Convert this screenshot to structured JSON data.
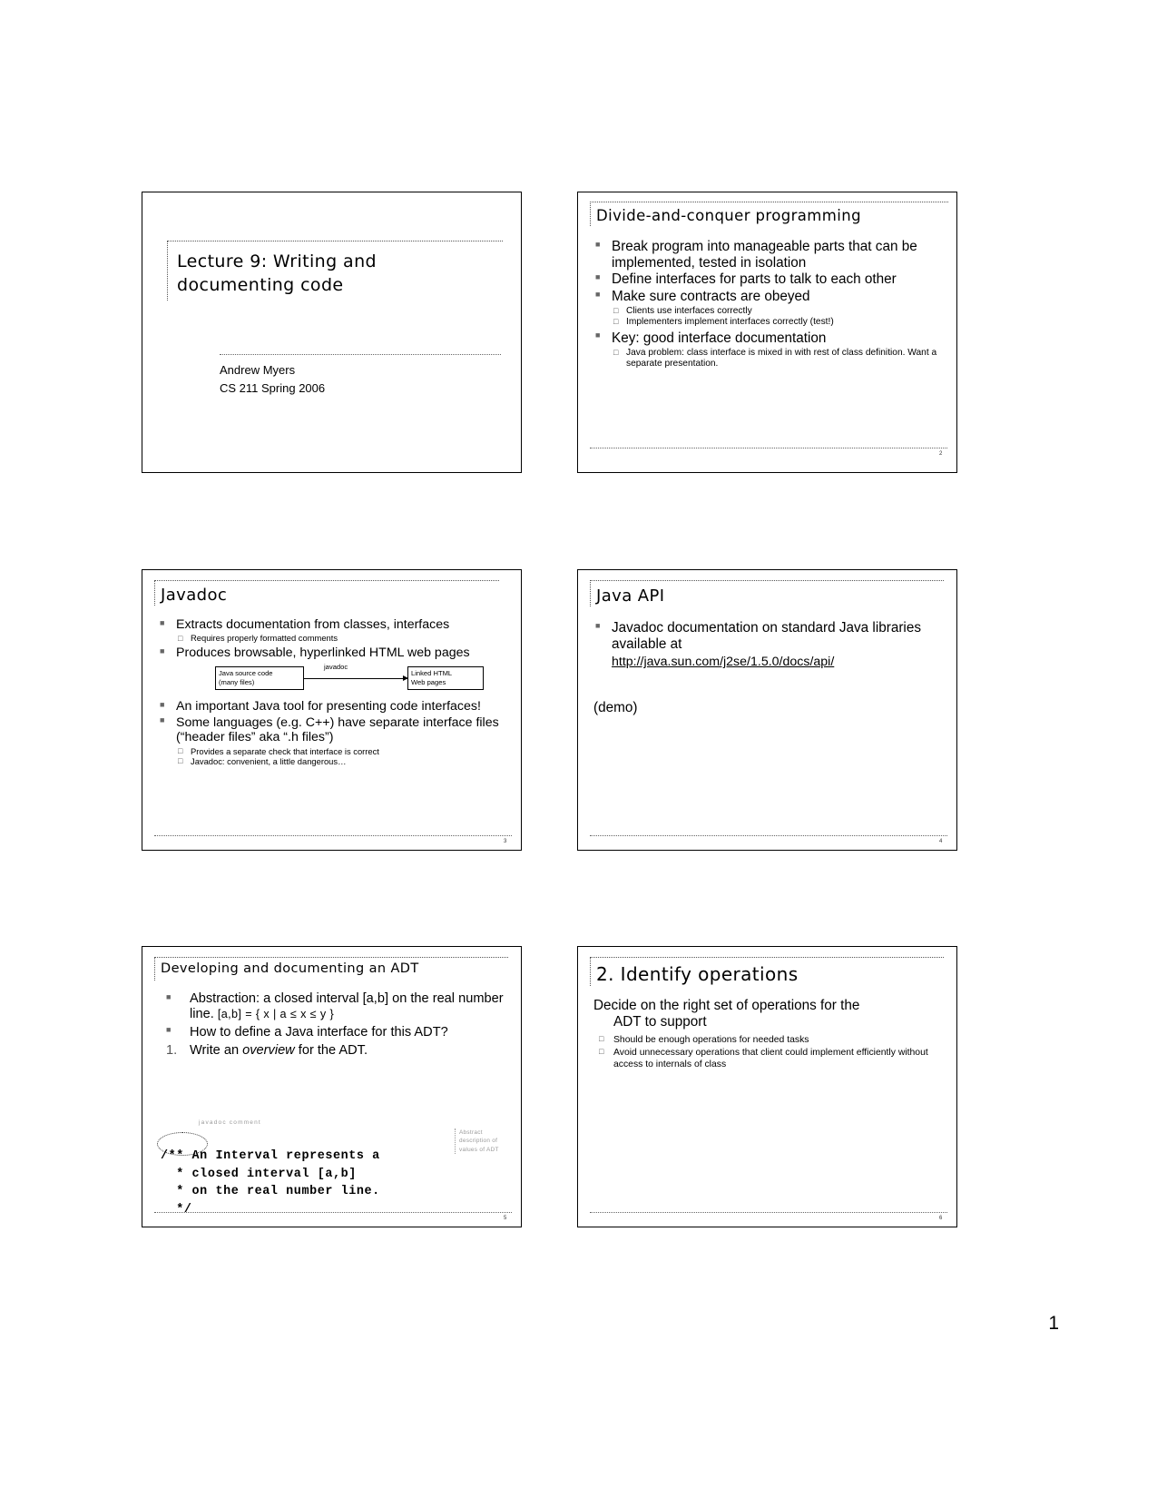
{
  "document": {
    "page_number": "1"
  },
  "slides": [
    {
      "number": "",
      "title_line1": "Lecture 9: Writing and",
      "title_line2": "documenting code",
      "author": "Andrew Myers",
      "course": "CS 211 Spring 2006"
    },
    {
      "number": "2",
      "title": "Divide-and-conquer programming",
      "bullets": [
        {
          "text": "Break program into manageable parts that can be implemented, tested in isolation",
          "sub": []
        },
        {
          "text": "Define interfaces for parts to talk to each other",
          "sub": []
        },
        {
          "text": "Make sure contracts are obeyed",
          "sub": [
            "Clients use interfaces correctly",
            "Implementers implement interfaces correctly (test!)"
          ]
        },
        {
          "text": "Key: good interface documentation",
          "sub": [
            "Java problem: class interface is mixed in with rest of class definition. Want a separate presentation."
          ]
        }
      ]
    },
    {
      "number": "3",
      "title": "Javadoc",
      "bullets": [
        {
          "text": "Extracts documentation from classes, interfaces",
          "sub": [
            "Requires properly formatted comments"
          ]
        },
        {
          "text": "Produces browsable, hyperlinked HTML web pages",
          "sub": []
        },
        {
          "text": "An important Java tool for presenting code interfaces!",
          "sub": []
        },
        {
          "text": "Some languages (e.g. C++) have separate interface files (“header files” aka “.h files”)",
          "sub": [
            "Provides a separate check that interface is correct",
            "Javadoc: convenient, a little dangerous…"
          ]
        }
      ],
      "diagram": {
        "source_line1": "Java source code",
        "source_line2": "(many files)",
        "arrow_label": "javadoc",
        "target_line1": "Linked HTML",
        "target_line2": "Web pages"
      }
    },
    {
      "number": "4",
      "title": "Java API",
      "bullets": [
        {
          "text": "Javadoc documentation on standard Java libraries available at",
          "sub": []
        }
      ],
      "url": "http://java.sun.com/j2se/1.5.0/docs/api/",
      "demo": "(demo)"
    },
    {
      "number": "5",
      "title": "Developing and documenting an ADT",
      "bullets": [
        {
          "text_a": "Abstraction: a closed interval [a,b] on the real number line. ",
          "text_b": "[a,b] = { x | a ≤ x ≤ y }"
        },
        {
          "text_a": "How to define a Java interface for this ADT?",
          "text_b": ""
        }
      ],
      "numbered": {
        "marker": "1.",
        "text_pre": "Write an ",
        "text_em": "overview",
        "text_post": " for the ADT."
      },
      "code": "/** An Interval represents a\n  * closed interval [a,b]\n  * on the real number line.\n  */",
      "annotation_top": "javadoc comment",
      "annotation_right": "Abstract description of values of ADT"
    },
    {
      "number": "6",
      "title": "2. Identify operations",
      "lead_line1": "Decide on the right set of operations for the",
      "lead_line2": "ADT to support",
      "sub": [
        "Should be enough operations for needed tasks",
        "Avoid unnecessary operations that client could implement efficiently without access to internals of class"
      ]
    }
  ]
}
